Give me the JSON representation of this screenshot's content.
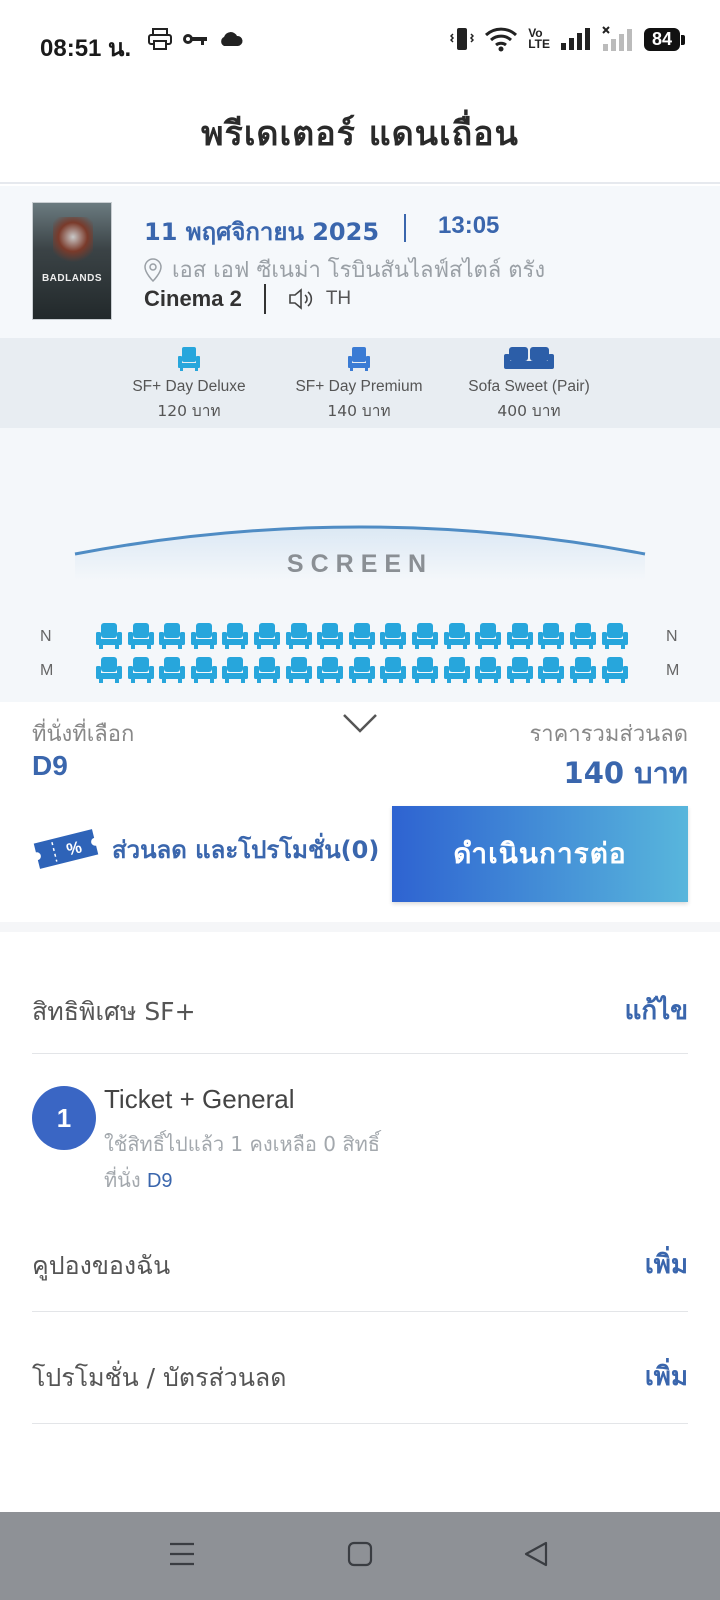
{
  "status_bar": {
    "time": "08:51 น.",
    "battery": "84",
    "volte": [
      "Vo",
      "LTE"
    ]
  },
  "header": {
    "title": "พรีเดเตอร์ แดนเถื่อน"
  },
  "movie": {
    "poster_text": "BADLANDS",
    "date": "11 พฤศจิกายน 2025",
    "time": "13:05",
    "location": "เอส เอฟ ซีเนม่า โรบินสันไลฟ์สไตล์ ตรัง",
    "hall": "Cinema 2",
    "audio_language": "TH"
  },
  "seat_types": [
    {
      "name": "SF+ Day Deluxe",
      "price": "120 บาท",
      "icon": "armchair-icon"
    },
    {
      "name": "SF+ Day Premium",
      "price": "140 บาท",
      "icon": "armchair-icon"
    },
    {
      "name": "Sofa Sweet (Pair)",
      "price": "400 บาท",
      "icon": "sofa-icon"
    }
  ],
  "seat_map": {
    "screen_label": "SCREEN",
    "rows": [
      "N",
      "M"
    ],
    "seats_per_row": 17
  },
  "summary": {
    "selected_label": "ที่นั่งที่เลือก",
    "selected_value": "D9",
    "total_label": "ราคารวมส่วนลด",
    "total_value": "140 บาท",
    "promo_label": "ส่วนลด และโปรโมชั่น(0)",
    "continue_label": "ดำเนินการต่อ"
  },
  "privileges": {
    "label": "สิทธิพิเศษ SF+",
    "action": "แก้ไข"
  },
  "ticket": {
    "number": "1",
    "name": "Ticket + General",
    "usage": "ใช้สิทธิ์ไปแล้ว 1 คงเหลือ 0 สิทธิ์",
    "seat_prefix": "ที่นั่ง",
    "seat_value": "D9"
  },
  "coupons": {
    "label": "คูปองของฉัน",
    "action": "เพิ่ม"
  },
  "promotions": {
    "label": "โปรโมชั่น / บัตรส่วนลด",
    "action": "เพิ่ม"
  },
  "colors": {
    "accent": "#3a66ad",
    "seat": "#27a6dc",
    "nav_bar": "#8e9196"
  }
}
